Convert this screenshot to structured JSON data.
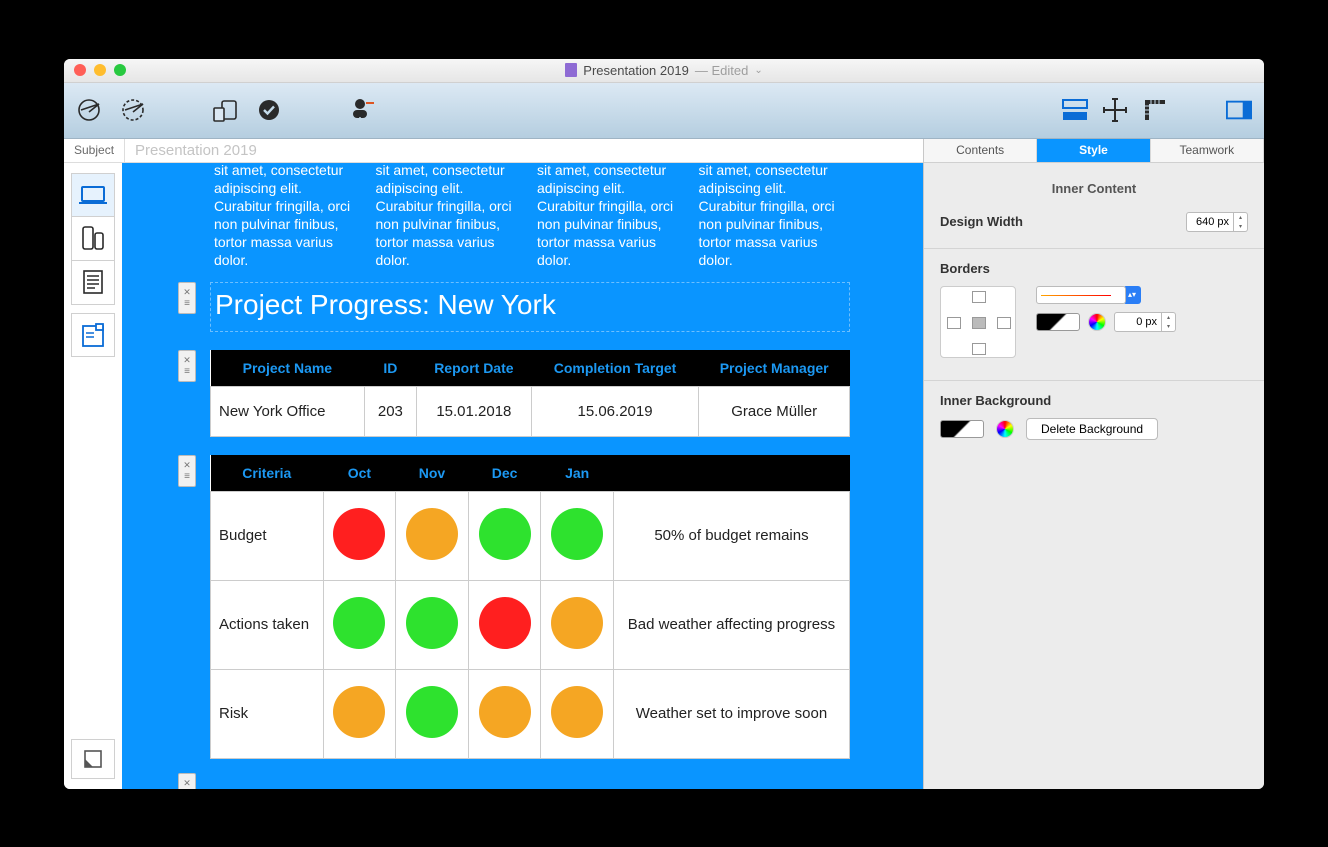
{
  "window": {
    "title": "Presentation 2019",
    "status": "— Edited"
  },
  "subject": {
    "label": "Subject",
    "value": "Presentation 2019"
  },
  "lorem": "sit amet, consectetur adipiscing elit. Curabitur fringilla, orci non pulvinar finibus, tortor massa varius dolor.",
  "heading": "Project Progress: New York",
  "table1": {
    "headers": [
      "Project Name",
      "ID",
      "Report Date",
      "Completion Target",
      "Project Manager"
    ],
    "row": [
      "New York Office",
      "203",
      "15.01.2018",
      "15.06.2019",
      "Grace Müller"
    ]
  },
  "table2": {
    "headers": [
      "Criteria",
      "Oct",
      "Nov",
      "Dec",
      "Jan",
      ""
    ],
    "rows": [
      {
        "label": "Budget",
        "dots": [
          "red",
          "orange",
          "green",
          "green"
        ],
        "note": "50% of budget remains"
      },
      {
        "label": "Actions taken",
        "dots": [
          "green",
          "green",
          "red",
          "orange"
        ],
        "note": "Bad weather affecting progress"
      },
      {
        "label": "Risk",
        "dots": [
          "orange",
          "green",
          "orange",
          "orange"
        ],
        "note": "Weather set to improve soon"
      }
    ]
  },
  "inspector": {
    "tabs": [
      "Contents",
      "Style",
      "Teamwork"
    ],
    "innerContent": {
      "title": "Inner Content",
      "designWidthLabel": "Design Width",
      "designWidthValue": "640 px"
    },
    "borders": {
      "label": "Borders",
      "widthValue": "0 px"
    },
    "background": {
      "label": "Inner Background",
      "deleteBtn": "Delete Background"
    }
  }
}
